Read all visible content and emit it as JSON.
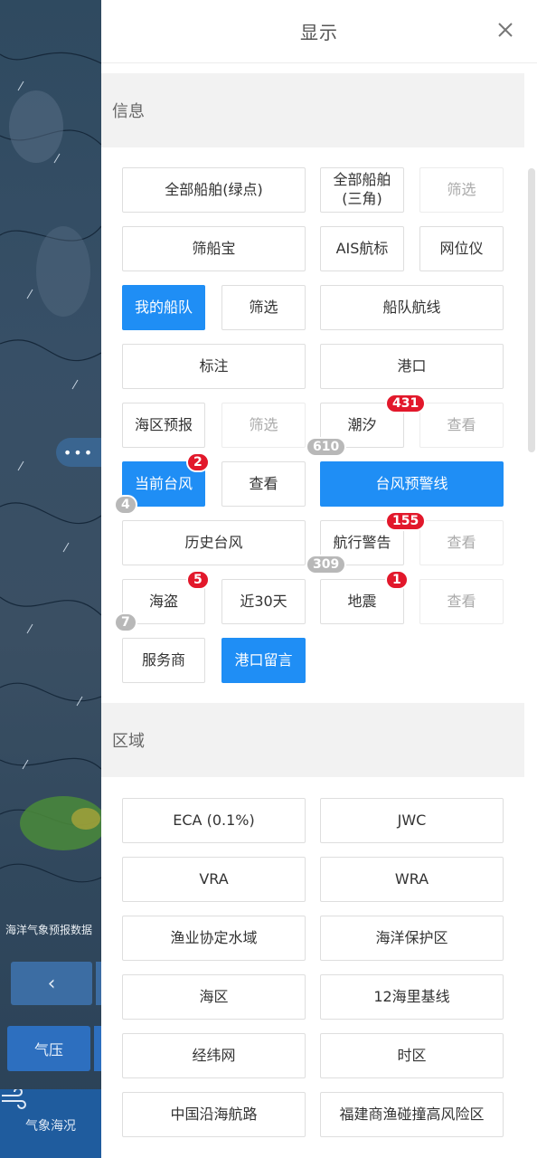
{
  "map": {
    "note": "海洋气象预报数据",
    "back_icon": "‹",
    "pressure_label": "气压",
    "tab_label": "气象海况",
    "tab_icon": "wind-icon",
    "dots": "•••"
  },
  "panel": {
    "title": "显示",
    "close_icon": "close-icon"
  },
  "info": {
    "section_title": "信息",
    "buttons": {
      "all_ships_dot": "全部船舶(绿点)",
      "all_ships_tri": "全部船舶\n(三角)",
      "filter1": "筛选",
      "shaichuanbao": "筛船宝",
      "ais": "AIS航标",
      "net_locator": "网位仪",
      "my_fleet": "我的船队",
      "filter2": "筛选",
      "fleet_route": "船队航线",
      "annotation": "标注",
      "port": "港口",
      "sea_forecast": "海区预报",
      "filter3": "筛选",
      "tide": "潮汐",
      "view1": "查看",
      "current_typhoon": "当前台风",
      "view2": "查看",
      "typhoon_warning": "台风预警线",
      "history_typhoon": "历史台风",
      "nav_warning": "航行警告",
      "view3": "查看",
      "pirate": "海盗",
      "last30": "近30天",
      "earthquake": "地震",
      "view4": "查看",
      "service": "服务商",
      "port_message": "港口留言"
    },
    "badges": {
      "tide": "431",
      "tide_gray": "610",
      "typhoon": "2",
      "typhoon_gray": "4",
      "nav_warning": "155",
      "nav_gray": "309",
      "pirate": "5",
      "pirate_gray": "7",
      "earthquake": "1"
    }
  },
  "area": {
    "section_title": "区域",
    "buttons": {
      "eca": "ECA (0.1%)",
      "jwc": "JWC",
      "vra": "VRA",
      "wra": "WRA",
      "fishery": "渔业协定水域",
      "marine_protect": "海洋保护区",
      "sea_area": "海区",
      "baseline": "12海里基线",
      "graticule": "经纬网",
      "timezone": "时区",
      "coastal_route": "中国沿海航路",
      "fujian_risk": "福建商渔碰撞高风险区"
    }
  }
}
